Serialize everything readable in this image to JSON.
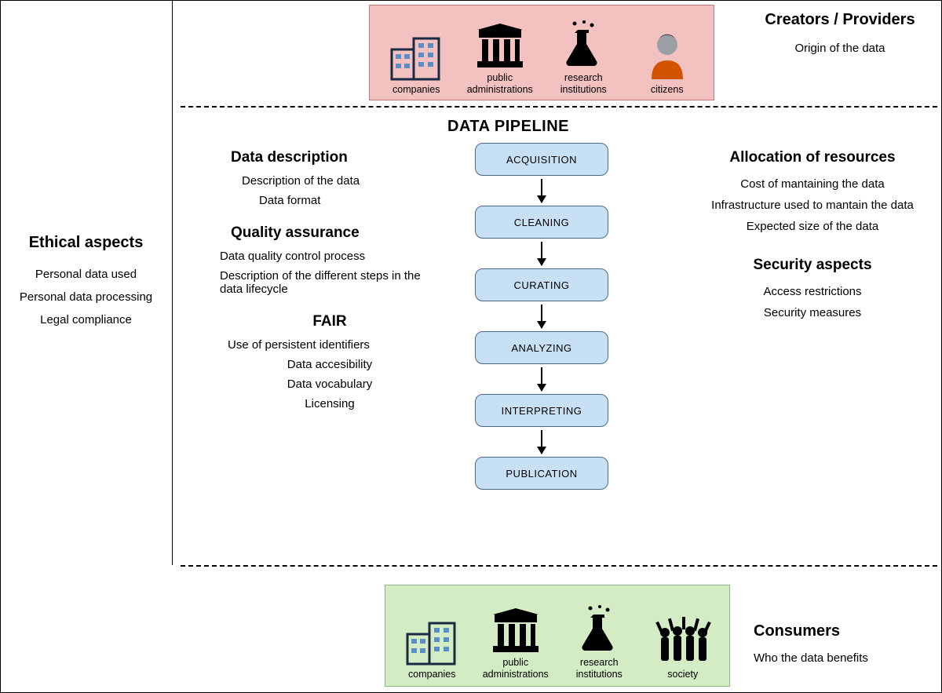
{
  "ethical": {
    "title": "Ethical aspects",
    "items": [
      "Personal data used",
      "Personal data processing",
      "Legal compliance"
    ]
  },
  "creators": {
    "title": "Creators / Providers",
    "subtitle": "Origin of the data",
    "actors": [
      {
        "icon": "buildings",
        "label": "companies"
      },
      {
        "icon": "museum",
        "label": "public administrations"
      },
      {
        "icon": "flask",
        "label": "research institutions"
      },
      {
        "icon": "citizen",
        "label": "citizens"
      }
    ]
  },
  "pipeline": {
    "title": "DATA PIPELINE",
    "stages": [
      "ACQUISITION",
      "CLEANING",
      "CURATING",
      "ANALYZING",
      "INTERPRETING",
      "PUBLICATION"
    ]
  },
  "mid_left_blocks": [
    {
      "title": "Data description",
      "items": [
        "Description of the data",
        "Data format"
      ]
    },
    {
      "title": "Quality assurance",
      "items": [
        "Data quality control process",
        "Description of the different steps in the data lifecycle"
      ]
    },
    {
      "title": "FAIR",
      "items": [
        "Use of persistent identifiers",
        "Data accesibility",
        "Data vocabulary",
        "Licensing"
      ]
    }
  ],
  "mid_right_blocks": [
    {
      "title": "Allocation of resources",
      "items": [
        "Cost of mantaining the data",
        "Infrastructure used to mantain the data",
        "Expected size of the data"
      ]
    },
    {
      "title": "Security aspects",
      "items": [
        "Access restrictions",
        "Security measures"
      ]
    }
  ],
  "consumers": {
    "title": "Consumers",
    "subtitle": "Who the data benefits",
    "actors": [
      {
        "icon": "buildings",
        "label": "companies"
      },
      {
        "icon": "museum",
        "label": "public administrations"
      },
      {
        "icon": "flask",
        "label": "research institutions"
      },
      {
        "icon": "society",
        "label": "society"
      }
    ]
  }
}
